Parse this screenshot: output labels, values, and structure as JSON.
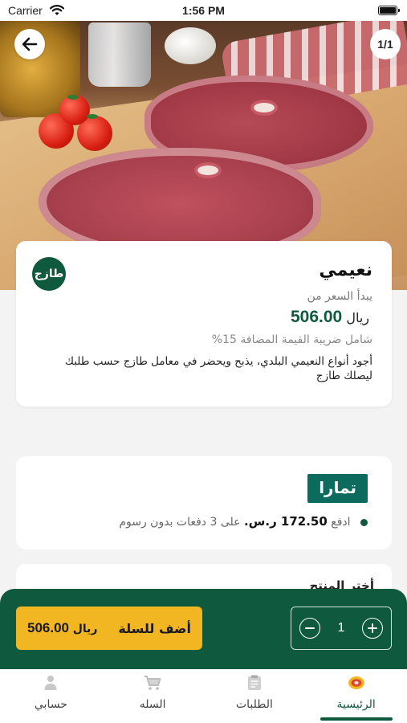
{
  "status_bar": {
    "carrier": "Carrier",
    "time": "1:56 PM"
  },
  "hero": {
    "pager": "1/1",
    "back_icon": "arrow-left-icon"
  },
  "product": {
    "brand_logo_text": "طازج",
    "name": "نعيمي",
    "price_label": "يبدأ السعر من",
    "price_value": "506.00",
    "currency": "ريال",
    "vat_note": "شامل ضريبة القيمة المضافة 15%",
    "description": "أجود أنواع النعيمي البلدي، يذبح ويحضر في معامل طازج حسب طلبك ليصلك طازج"
  },
  "tamara": {
    "logo_text": "تمارا",
    "pay_prefix": "ادفع",
    "amount": "172.50 ر.س.",
    "pay_suffix": "على 3 دفعات بدون رسوم"
  },
  "options_section": {
    "title": "أختر المنتج"
  },
  "cart_bar": {
    "price_value": "506.00",
    "currency": "ريال",
    "add_label": "أضف للسلة",
    "quantity": "1"
  },
  "bottom_nav": {
    "items": [
      {
        "label": "الرئيسية",
        "icon": "home-logo-icon",
        "active": true
      },
      {
        "label": "الطلبات",
        "icon": "orders-clipboard-icon",
        "active": false
      },
      {
        "label": "السله",
        "icon": "cart-icon",
        "active": false
      },
      {
        "label": "حسابي",
        "icon": "user-icon",
        "active": false
      }
    ]
  },
  "colors": {
    "brand_green": "#0f5a3f",
    "accent_yellow": "#f2b622",
    "tamara_teal": "#0d6b5e"
  }
}
